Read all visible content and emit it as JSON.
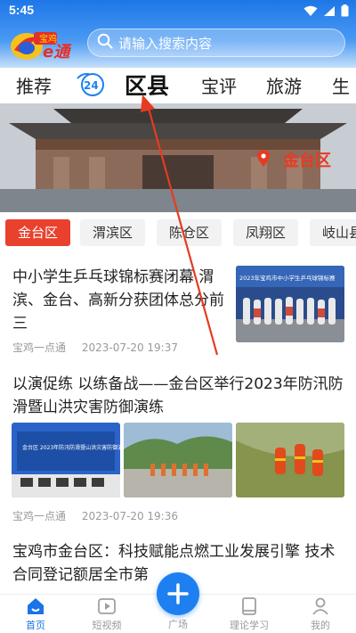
{
  "status_bar": {
    "time": "5:45"
  },
  "header": {
    "logo_text_top": "宝鸡",
    "logo_text_main": "e通",
    "search_placeholder": "请输入搜索内容"
  },
  "tabs": [
    {
      "label": "推荐"
    },
    {
      "label": "24"
    },
    {
      "label": "区县",
      "active": true
    },
    {
      "label": "宝评"
    },
    {
      "label": "旅游"
    },
    {
      "label": "生"
    }
  ],
  "banner": {
    "location": "金台区"
  },
  "districts": [
    {
      "label": "金台区",
      "active": true
    },
    {
      "label": "渭滨区"
    },
    {
      "label": "陈仓区"
    },
    {
      "label": "凤翔区"
    },
    {
      "label": "岐山县"
    }
  ],
  "articles": [
    {
      "title": "中小学生乒乓球锦标赛闭幕 渭滨、金台、高新分获团体总分前三",
      "source": "宝鸡一点通",
      "time": "2023-07-20 19:37",
      "thumb_caption": "2023年宝鸡市中小学生乒乓球锦标赛"
    },
    {
      "title": "以演促练 以练备战——金台区举行2023年防汛防滑暨山洪灾害防御演练",
      "source": "宝鸡一点通",
      "time": "2023-07-20 19:36",
      "thumb_caption": "金台区 2023年防汛防滑暨山洪灾害防御演练"
    },
    {
      "title": "宝鸡市金台区：科技赋能点燃工业发展引擎 技术合同登记额居全市第"
    }
  ],
  "bottom_nav": [
    {
      "label": "首页",
      "active": true
    },
    {
      "label": "短视频"
    },
    {
      "label": "广场"
    },
    {
      "label": "理论学习"
    },
    {
      "label": "我的"
    }
  ],
  "colors": {
    "brand_blue": "#1e80f0",
    "accent_red": "#e9412d",
    "annotation_red": "#e53b22"
  }
}
